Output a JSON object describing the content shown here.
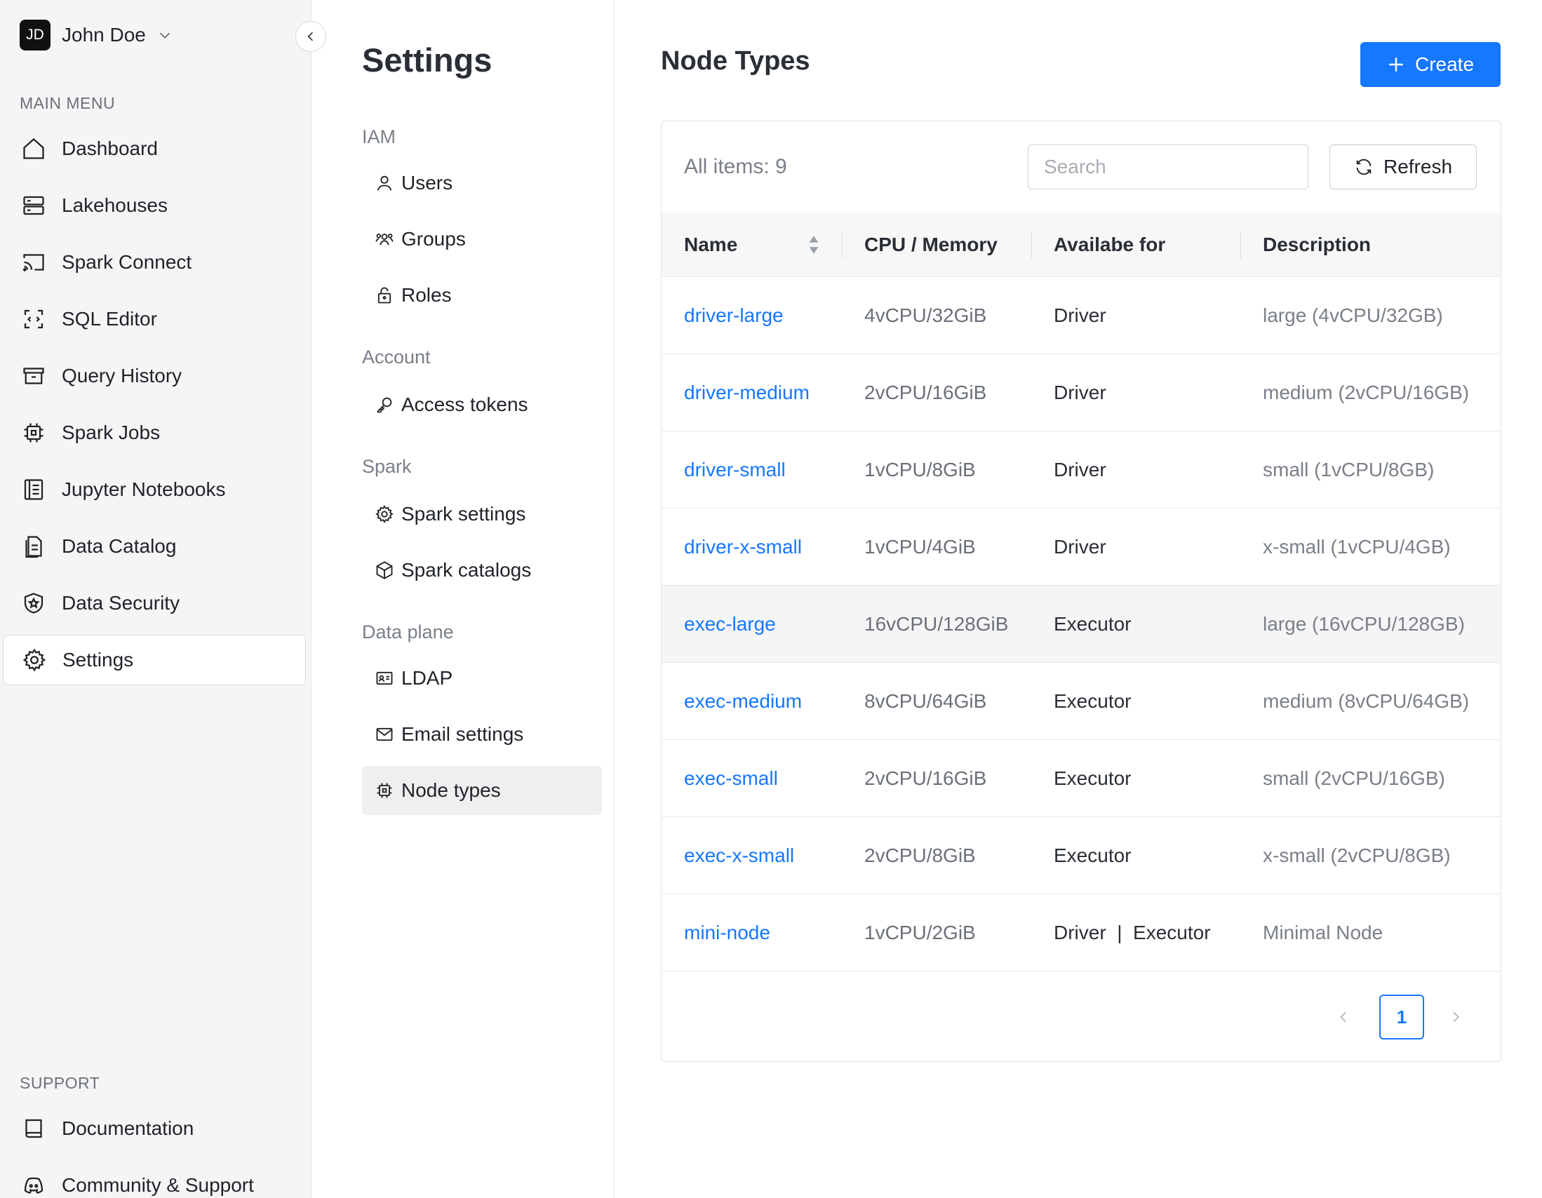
{
  "user": {
    "initials": "JD",
    "name": "John Doe"
  },
  "sidebar": {
    "main_label": "MAIN MENU",
    "items": [
      {
        "label": "Dashboard",
        "icon": "home-icon"
      },
      {
        "label": "Lakehouses",
        "icon": "server-icon"
      },
      {
        "label": "Spark Connect",
        "icon": "cast-icon"
      },
      {
        "label": "SQL Editor",
        "icon": "sql-editor-icon"
      },
      {
        "label": "Query History",
        "icon": "archive-icon"
      },
      {
        "label": "Spark Jobs",
        "icon": "chip-icon"
      },
      {
        "label": "Jupyter Notebooks",
        "icon": "notebook-icon"
      },
      {
        "label": "Data Catalog",
        "icon": "catalog-icon"
      },
      {
        "label": "Data Security",
        "icon": "shield-icon"
      },
      {
        "label": "Settings",
        "icon": "gear-icon",
        "active": true
      }
    ],
    "support_label": "SUPPORT",
    "support_items": [
      {
        "label": "Documentation",
        "icon": "book-icon"
      },
      {
        "label": "Community & Support",
        "icon": "discord-icon"
      }
    ]
  },
  "settings": {
    "title": "Settings",
    "groups": [
      {
        "label": "IAM",
        "items": [
          "Users",
          "Groups",
          "Roles"
        ]
      },
      {
        "label": "Account",
        "items": [
          "Access tokens"
        ]
      },
      {
        "label": "Spark",
        "items": [
          "Spark settings",
          "Spark catalogs"
        ]
      },
      {
        "label": "Data plane",
        "items": [
          "LDAP",
          "Email settings",
          "Node types"
        ]
      }
    ],
    "active": "Node types"
  },
  "main": {
    "title": "Node Types",
    "create_label": "Create",
    "all_items_label": "All items: 9",
    "search_placeholder": "Search",
    "refresh_label": "Refresh",
    "columns": [
      "Name",
      "CPU / Memory",
      "Availabe for",
      "Description"
    ],
    "rows": [
      {
        "name": "driver-large",
        "cpu": "4vCPU/32GiB",
        "available": "Driver",
        "description": "large (4vCPU/32GB)"
      },
      {
        "name": "driver-medium",
        "cpu": "2vCPU/16GiB",
        "available": "Driver",
        "description": "medium (2vCPU/16GB)"
      },
      {
        "name": "driver-small",
        "cpu": "1vCPU/8GiB",
        "available": "Driver",
        "description": "small (1vCPU/8GB)"
      },
      {
        "name": "driver-x-small",
        "cpu": "1vCPU/4GiB",
        "available": "Driver",
        "description": "x-small (1vCPU/4GB)"
      },
      {
        "name": "exec-large",
        "cpu": "16vCPU/128GiB",
        "available": "Executor",
        "description": "large (16vCPU/128GB)"
      },
      {
        "name": "exec-medium",
        "cpu": "8vCPU/64GiB",
        "available": "Executor",
        "description": "medium (8vCPU/64GB)"
      },
      {
        "name": "exec-small",
        "cpu": "2vCPU/16GiB",
        "available": "Executor",
        "description": "small (2vCPU/16GB)"
      },
      {
        "name": "exec-x-small",
        "cpu": "2vCPU/8GiB",
        "available": "Executor",
        "description": "x-small (2vCPU/8GB)"
      },
      {
        "name": "mini-node",
        "cpu": "1vCPU/2GiB",
        "available": "Driver  |  Executor",
        "description": "Minimal Node"
      }
    ],
    "pagination": {
      "current_page": "1"
    }
  },
  "colors": {
    "accent": "#1677ff",
    "sidebar_bg": "#f5f5f6"
  }
}
